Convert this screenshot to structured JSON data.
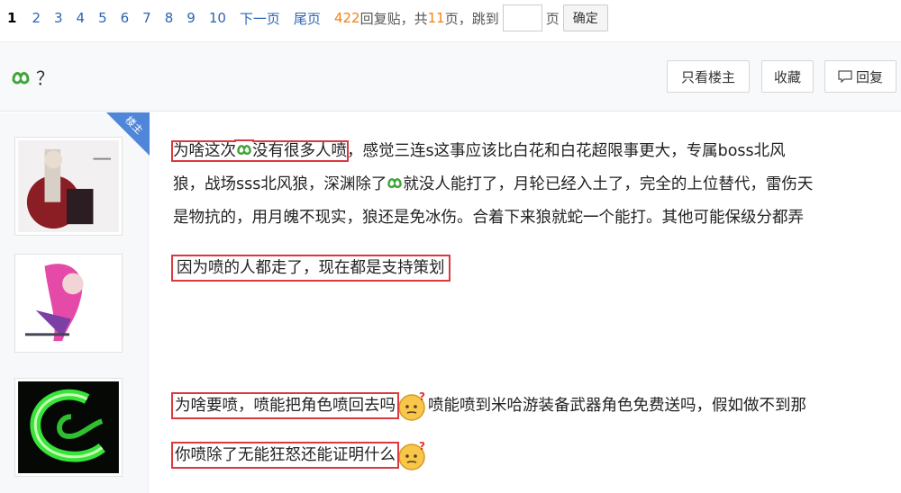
{
  "pager": {
    "pages": [
      "1",
      "2",
      "3",
      "4",
      "5",
      "6",
      "7",
      "8",
      "9",
      "10"
    ],
    "next": "下一页",
    "last": "尾页",
    "reply_count": "422",
    "reply_label": "回复贴，共",
    "total_pages": "11",
    "pages_unit": "页，跳到",
    "page_suffix": "页",
    "confirm": "确定"
  },
  "header": {
    "title_suffix": "？",
    "btn_only_op": "只看楼主",
    "btn_favorite": "收藏",
    "btn_reply": "回复"
  },
  "badge": {
    "op": "楼主"
  },
  "posts": {
    "p1_line1_boxed": "为啥这次",
    "p1_line1_boxed_b": "没有很多人喷",
    "p1_line1_rest": "，感觉三连s这事应该比白花和白花超限事更大，专属boss北风",
    "p1_line2_a": "狼，战场sss北风狼，深渊除了",
    "p1_line2_b": "就没人能打了，月轮已经入土了，完全的上位替代，雷伤天",
    "p1_line3": "是物抗的，用月魄不现实，狼还是免冰伤。合着下来狼就蛇一个能打。其他可能保级分都弄",
    "p2": "因为喷的人都走了，现在都是支持策划",
    "p3_boxed": "为啥要喷，喷能把角色喷回去吗",
    "p3_rest": "喷能喷到米哈游装备武器角色免费送吗，假如做不到那",
    "p4": "你喷除了无能狂怒还能证明什么"
  },
  "colors": {
    "link": "#2d64b3",
    "count": "#f7810d",
    "highlight": "#d9393f",
    "badge": "#4f86d9"
  }
}
